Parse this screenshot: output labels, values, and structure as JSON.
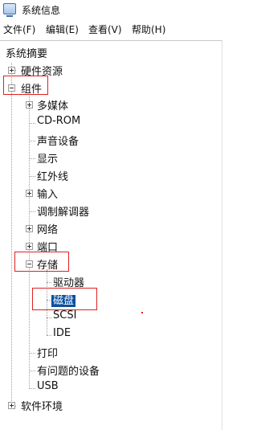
{
  "window": {
    "title": "系统信息"
  },
  "menubar": {
    "items": [
      "文件(F)",
      "编辑(E)",
      "查看(V)",
      "帮助(H)"
    ]
  },
  "tree": {
    "root": "系统摘要",
    "hardware": "硬件资源",
    "components": "组件",
    "multimedia": "多媒体",
    "cdrom": "CD-ROM",
    "sound": "声音设备",
    "display": "显示",
    "infrared": "红外线",
    "input": "输入",
    "modem": "调制解调器",
    "network": "网络",
    "ports": "端口",
    "storage": "存储",
    "drives": "驱动器",
    "disks": "磁盘",
    "scsi": "SCSI",
    "ide": "IDE",
    "printing": "打印",
    "problem_devices": "有问题的设备",
    "usb": "USB",
    "software": "软件环境"
  },
  "selected_node": "磁盘"
}
